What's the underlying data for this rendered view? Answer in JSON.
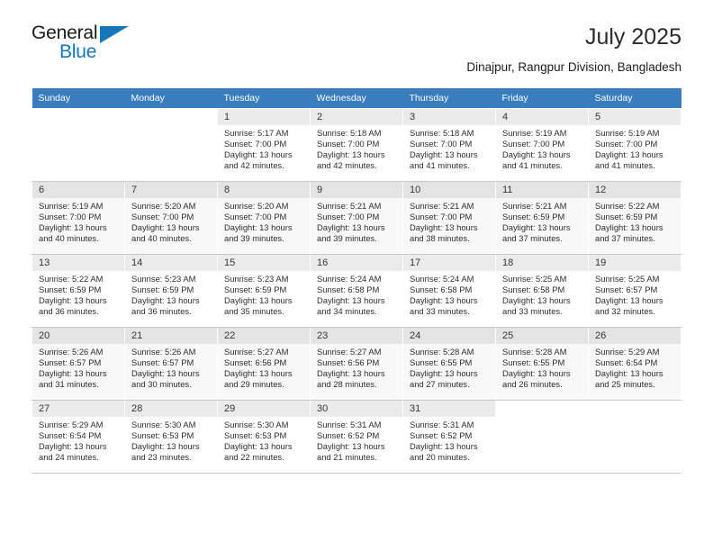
{
  "brand": {
    "name_part1": "General",
    "name_part2": "Blue",
    "accent_color": "#1576bc",
    "triangle_icon": "triangle-logo-icon"
  },
  "header": {
    "title": "July 2025",
    "subtitle": "Dinajpur, Rangpur Division, Bangladesh",
    "header_row_color": "#3a7dbf"
  },
  "labels": {
    "sunrise_prefix": "Sunrise:",
    "sunset_prefix": "Sunset:",
    "daylight_prefix": "Daylight:"
  },
  "weekdays": [
    "Sunday",
    "Monday",
    "Tuesday",
    "Wednesday",
    "Thursday",
    "Friday",
    "Saturday"
  ],
  "weeks": [
    [
      {
        "day": "",
        "sunrise": "",
        "sunset": "",
        "daylight_l1": "",
        "daylight_l2": ""
      },
      {
        "day": "",
        "sunrise": "",
        "sunset": "",
        "daylight_l1": "",
        "daylight_l2": ""
      },
      {
        "day": "1",
        "sunrise": "Sunrise: 5:17 AM",
        "sunset": "Sunset: 7:00 PM",
        "daylight_l1": "Daylight: 13 hours",
        "daylight_l2": "and 42 minutes."
      },
      {
        "day": "2",
        "sunrise": "Sunrise: 5:18 AM",
        "sunset": "Sunset: 7:00 PM",
        "daylight_l1": "Daylight: 13 hours",
        "daylight_l2": "and 42 minutes."
      },
      {
        "day": "3",
        "sunrise": "Sunrise: 5:18 AM",
        "sunset": "Sunset: 7:00 PM",
        "daylight_l1": "Daylight: 13 hours",
        "daylight_l2": "and 41 minutes."
      },
      {
        "day": "4",
        "sunrise": "Sunrise: 5:19 AM",
        "sunset": "Sunset: 7:00 PM",
        "daylight_l1": "Daylight: 13 hours",
        "daylight_l2": "and 41 minutes."
      },
      {
        "day": "5",
        "sunrise": "Sunrise: 5:19 AM",
        "sunset": "Sunset: 7:00 PM",
        "daylight_l1": "Daylight: 13 hours",
        "daylight_l2": "and 41 minutes."
      }
    ],
    [
      {
        "day": "6",
        "sunrise": "Sunrise: 5:19 AM",
        "sunset": "Sunset: 7:00 PM",
        "daylight_l1": "Daylight: 13 hours",
        "daylight_l2": "and 40 minutes."
      },
      {
        "day": "7",
        "sunrise": "Sunrise: 5:20 AM",
        "sunset": "Sunset: 7:00 PM",
        "daylight_l1": "Daylight: 13 hours",
        "daylight_l2": "and 40 minutes."
      },
      {
        "day": "8",
        "sunrise": "Sunrise: 5:20 AM",
        "sunset": "Sunset: 7:00 PM",
        "daylight_l1": "Daylight: 13 hours",
        "daylight_l2": "and 39 minutes."
      },
      {
        "day": "9",
        "sunrise": "Sunrise: 5:21 AM",
        "sunset": "Sunset: 7:00 PM",
        "daylight_l1": "Daylight: 13 hours",
        "daylight_l2": "and 39 minutes."
      },
      {
        "day": "10",
        "sunrise": "Sunrise: 5:21 AM",
        "sunset": "Sunset: 7:00 PM",
        "daylight_l1": "Daylight: 13 hours",
        "daylight_l2": "and 38 minutes."
      },
      {
        "day": "11",
        "sunrise": "Sunrise: 5:21 AM",
        "sunset": "Sunset: 6:59 PM",
        "daylight_l1": "Daylight: 13 hours",
        "daylight_l2": "and 37 minutes."
      },
      {
        "day": "12",
        "sunrise": "Sunrise: 5:22 AM",
        "sunset": "Sunset: 6:59 PM",
        "daylight_l1": "Daylight: 13 hours",
        "daylight_l2": "and 37 minutes."
      }
    ],
    [
      {
        "day": "13",
        "sunrise": "Sunrise: 5:22 AM",
        "sunset": "Sunset: 6:59 PM",
        "daylight_l1": "Daylight: 13 hours",
        "daylight_l2": "and 36 minutes."
      },
      {
        "day": "14",
        "sunrise": "Sunrise: 5:23 AM",
        "sunset": "Sunset: 6:59 PM",
        "daylight_l1": "Daylight: 13 hours",
        "daylight_l2": "and 36 minutes."
      },
      {
        "day": "15",
        "sunrise": "Sunrise: 5:23 AM",
        "sunset": "Sunset: 6:59 PM",
        "daylight_l1": "Daylight: 13 hours",
        "daylight_l2": "and 35 minutes."
      },
      {
        "day": "16",
        "sunrise": "Sunrise: 5:24 AM",
        "sunset": "Sunset: 6:58 PM",
        "daylight_l1": "Daylight: 13 hours",
        "daylight_l2": "and 34 minutes."
      },
      {
        "day": "17",
        "sunrise": "Sunrise: 5:24 AM",
        "sunset": "Sunset: 6:58 PM",
        "daylight_l1": "Daylight: 13 hours",
        "daylight_l2": "and 33 minutes."
      },
      {
        "day": "18",
        "sunrise": "Sunrise: 5:25 AM",
        "sunset": "Sunset: 6:58 PM",
        "daylight_l1": "Daylight: 13 hours",
        "daylight_l2": "and 33 minutes."
      },
      {
        "day": "19",
        "sunrise": "Sunrise: 5:25 AM",
        "sunset": "Sunset: 6:57 PM",
        "daylight_l1": "Daylight: 13 hours",
        "daylight_l2": "and 32 minutes."
      }
    ],
    [
      {
        "day": "20",
        "sunrise": "Sunrise: 5:26 AM",
        "sunset": "Sunset: 6:57 PM",
        "daylight_l1": "Daylight: 13 hours",
        "daylight_l2": "and 31 minutes."
      },
      {
        "day": "21",
        "sunrise": "Sunrise: 5:26 AM",
        "sunset": "Sunset: 6:57 PM",
        "daylight_l1": "Daylight: 13 hours",
        "daylight_l2": "and 30 minutes."
      },
      {
        "day": "22",
        "sunrise": "Sunrise: 5:27 AM",
        "sunset": "Sunset: 6:56 PM",
        "daylight_l1": "Daylight: 13 hours",
        "daylight_l2": "and 29 minutes."
      },
      {
        "day": "23",
        "sunrise": "Sunrise: 5:27 AM",
        "sunset": "Sunset: 6:56 PM",
        "daylight_l1": "Daylight: 13 hours",
        "daylight_l2": "and 28 minutes."
      },
      {
        "day": "24",
        "sunrise": "Sunrise: 5:28 AM",
        "sunset": "Sunset: 6:55 PM",
        "daylight_l1": "Daylight: 13 hours",
        "daylight_l2": "and 27 minutes."
      },
      {
        "day": "25",
        "sunrise": "Sunrise: 5:28 AM",
        "sunset": "Sunset: 6:55 PM",
        "daylight_l1": "Daylight: 13 hours",
        "daylight_l2": "and 26 minutes."
      },
      {
        "day": "26",
        "sunrise": "Sunrise: 5:29 AM",
        "sunset": "Sunset: 6:54 PM",
        "daylight_l1": "Daylight: 13 hours",
        "daylight_l2": "and 25 minutes."
      }
    ],
    [
      {
        "day": "27",
        "sunrise": "Sunrise: 5:29 AM",
        "sunset": "Sunset: 6:54 PM",
        "daylight_l1": "Daylight: 13 hours",
        "daylight_l2": "and 24 minutes."
      },
      {
        "day": "28",
        "sunrise": "Sunrise: 5:30 AM",
        "sunset": "Sunset: 6:53 PM",
        "daylight_l1": "Daylight: 13 hours",
        "daylight_l2": "and 23 minutes."
      },
      {
        "day": "29",
        "sunrise": "Sunrise: 5:30 AM",
        "sunset": "Sunset: 6:53 PM",
        "daylight_l1": "Daylight: 13 hours",
        "daylight_l2": "and 22 minutes."
      },
      {
        "day": "30",
        "sunrise": "Sunrise: 5:31 AM",
        "sunset": "Sunset: 6:52 PM",
        "daylight_l1": "Daylight: 13 hours",
        "daylight_l2": "and 21 minutes."
      },
      {
        "day": "31",
        "sunrise": "Sunrise: 5:31 AM",
        "sunset": "Sunset: 6:52 PM",
        "daylight_l1": "Daylight: 13 hours",
        "daylight_l2": "and 20 minutes."
      },
      {
        "day": "",
        "sunrise": "",
        "sunset": "",
        "daylight_l1": "",
        "daylight_l2": ""
      },
      {
        "day": "",
        "sunrise": "",
        "sunset": "",
        "daylight_l1": "",
        "daylight_l2": ""
      }
    ]
  ]
}
